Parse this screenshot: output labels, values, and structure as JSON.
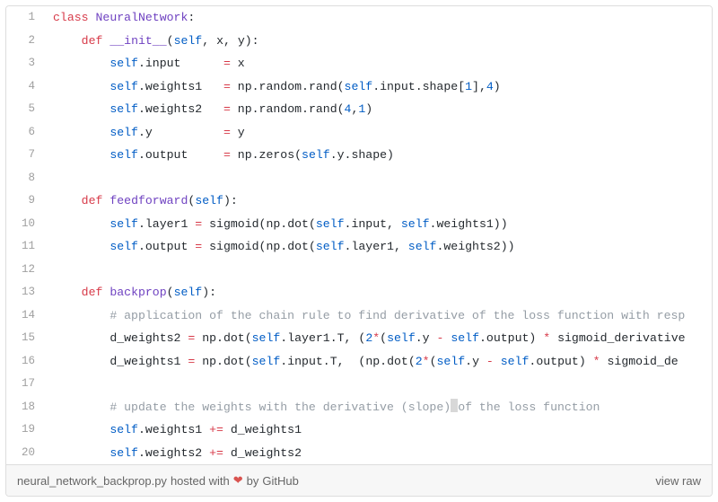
{
  "code": {
    "lines": [
      {
        "n": "1",
        "html": "<span class='k'>class</span> <span class='nc'>NeuralNetwork</span><span class='p'>:</span>"
      },
      {
        "n": "2",
        "html": "    <span class='k'>def</span> <span class='nf'>__init__</span><span class='p'>(</span><span class='bp'>self</span><span class='p'>,</span> <span class='n'>x</span><span class='p'>,</span> <span class='n'>y</span><span class='p'>):</span>"
      },
      {
        "n": "3",
        "html": "        <span class='bp'>self</span><span class='p'>.</span><span class='n'>input</span>      <span class='o'>=</span> <span class='n'>x</span>"
      },
      {
        "n": "4",
        "html": "        <span class='bp'>self</span><span class='p'>.</span><span class='n'>weights1</span>   <span class='o'>=</span> <span class='n'>np</span><span class='p'>.</span><span class='n'>random</span><span class='p'>.</span><span class='n'>rand</span><span class='p'>(</span><span class='bp'>self</span><span class='p'>.</span><span class='n'>input</span><span class='p'>.</span><span class='n'>shape</span><span class='p'>[</span><span class='mi'>1</span><span class='p'>],</span><span class='mi'>4</span><span class='p'>)</span>"
      },
      {
        "n": "5",
        "html": "        <span class='bp'>self</span><span class='p'>.</span><span class='n'>weights2</span>   <span class='o'>=</span> <span class='n'>np</span><span class='p'>.</span><span class='n'>random</span><span class='p'>.</span><span class='n'>rand</span><span class='p'>(</span><span class='mi'>4</span><span class='p'>,</span><span class='mi'>1</span><span class='p'>)</span>"
      },
      {
        "n": "6",
        "html": "        <span class='bp'>self</span><span class='p'>.</span><span class='n'>y</span>          <span class='o'>=</span> <span class='n'>y</span>"
      },
      {
        "n": "7",
        "html": "        <span class='bp'>self</span><span class='p'>.</span><span class='n'>output</span>     <span class='o'>=</span> <span class='n'>np</span><span class='p'>.</span><span class='n'>zeros</span><span class='p'>(</span><span class='bp'>self</span><span class='p'>.</span><span class='n'>y</span><span class='p'>.</span><span class='n'>shape</span><span class='p'>)</span>"
      },
      {
        "n": "8",
        "html": ""
      },
      {
        "n": "9",
        "html": "    <span class='k'>def</span> <span class='nf'>feedforward</span><span class='p'>(</span><span class='bp'>self</span><span class='p'>):</span>"
      },
      {
        "n": "10",
        "html": "        <span class='bp'>self</span><span class='p'>.</span><span class='n'>layer1</span> <span class='o'>=</span> <span class='n'>sigmoid</span><span class='p'>(</span><span class='n'>np</span><span class='p'>.</span><span class='n'>dot</span><span class='p'>(</span><span class='bp'>self</span><span class='p'>.</span><span class='n'>input</span><span class='p'>,</span> <span class='bp'>self</span><span class='p'>.</span><span class='n'>weights1</span><span class='p'>))</span>"
      },
      {
        "n": "11",
        "html": "        <span class='bp'>self</span><span class='p'>.</span><span class='n'>output</span> <span class='o'>=</span> <span class='n'>sigmoid</span><span class='p'>(</span><span class='n'>np</span><span class='p'>.</span><span class='n'>dot</span><span class='p'>(</span><span class='bp'>self</span><span class='p'>.</span><span class='n'>layer1</span><span class='p'>,</span> <span class='bp'>self</span><span class='p'>.</span><span class='n'>weights2</span><span class='p'>))</span>"
      },
      {
        "n": "12",
        "html": ""
      },
      {
        "n": "13",
        "html": "    <span class='k'>def</span> <span class='nf'>backprop</span><span class='p'>(</span><span class='bp'>self</span><span class='p'>):</span>"
      },
      {
        "n": "14",
        "html": "        <span class='c'># application of the chain rule to find derivative of the loss function with resp</span>"
      },
      {
        "n": "15",
        "html": "        <span class='n'>d_weights2</span> <span class='o'>=</span> <span class='n'>np</span><span class='p'>.</span><span class='n'>dot</span><span class='p'>(</span><span class='bp'>self</span><span class='p'>.</span><span class='n'>layer1</span><span class='p'>.</span><span class='n'>T</span><span class='p'>,</span> <span class='p'>(</span><span class='mi'>2</span><span class='o'>*</span><span class='p'>(</span><span class='bp'>self</span><span class='p'>.</span><span class='n'>y</span> <span class='o'>-</span> <span class='bp'>self</span><span class='p'>.</span><span class='n'>output</span><span class='p'>)</span> <span class='o'>*</span> <span class='n'>sigmoid_derivative</span>"
      },
      {
        "n": "16",
        "html": "        <span class='n'>d_weights1</span> <span class='o'>=</span> <span class='n'>np</span><span class='p'>.</span><span class='n'>dot</span><span class='p'>(</span><span class='bp'>self</span><span class='p'>.</span><span class='n'>input</span><span class='p'>.</span><span class='n'>T</span><span class='p'>,</span>  <span class='p'>(</span><span class='n'>np</span><span class='p'>.</span><span class='n'>dot</span><span class='p'>(</span><span class='mi'>2</span><span class='o'>*</span><span class='p'>(</span><span class='bp'>self</span><span class='p'>.</span><span class='n'>y</span> <span class='o'>-</span> <span class='bp'>self</span><span class='p'>.</span><span class='n'>output</span><span class='p'>)</span> <span class='o'>*</span> <span class='n'>sigmoid_de</span>"
      },
      {
        "n": "17",
        "html": ""
      },
      {
        "n": "18",
        "html": "        <span class='c'># update the weights with the derivative (slope)<span class='cursor-block'></span>of the loss function</span>"
      },
      {
        "n": "19",
        "html": "        <span class='bp'>self</span><span class='p'>.</span><span class='n'>weights1</span> <span class='o'>+=</span> <span class='n'>d_weights1</span>"
      },
      {
        "n": "20",
        "html": "        <span class='bp'>self</span><span class='p'>.</span><span class='n'>weights2</span> <span class='o'>+=</span> <span class='n'>d_weights2</span>"
      }
    ]
  },
  "meta": {
    "filename": "neural_network_backprop.py",
    "hosted": " hosted with ",
    "heart": "❤",
    "by": " by ",
    "host": "GitHub",
    "viewraw": "view raw"
  }
}
